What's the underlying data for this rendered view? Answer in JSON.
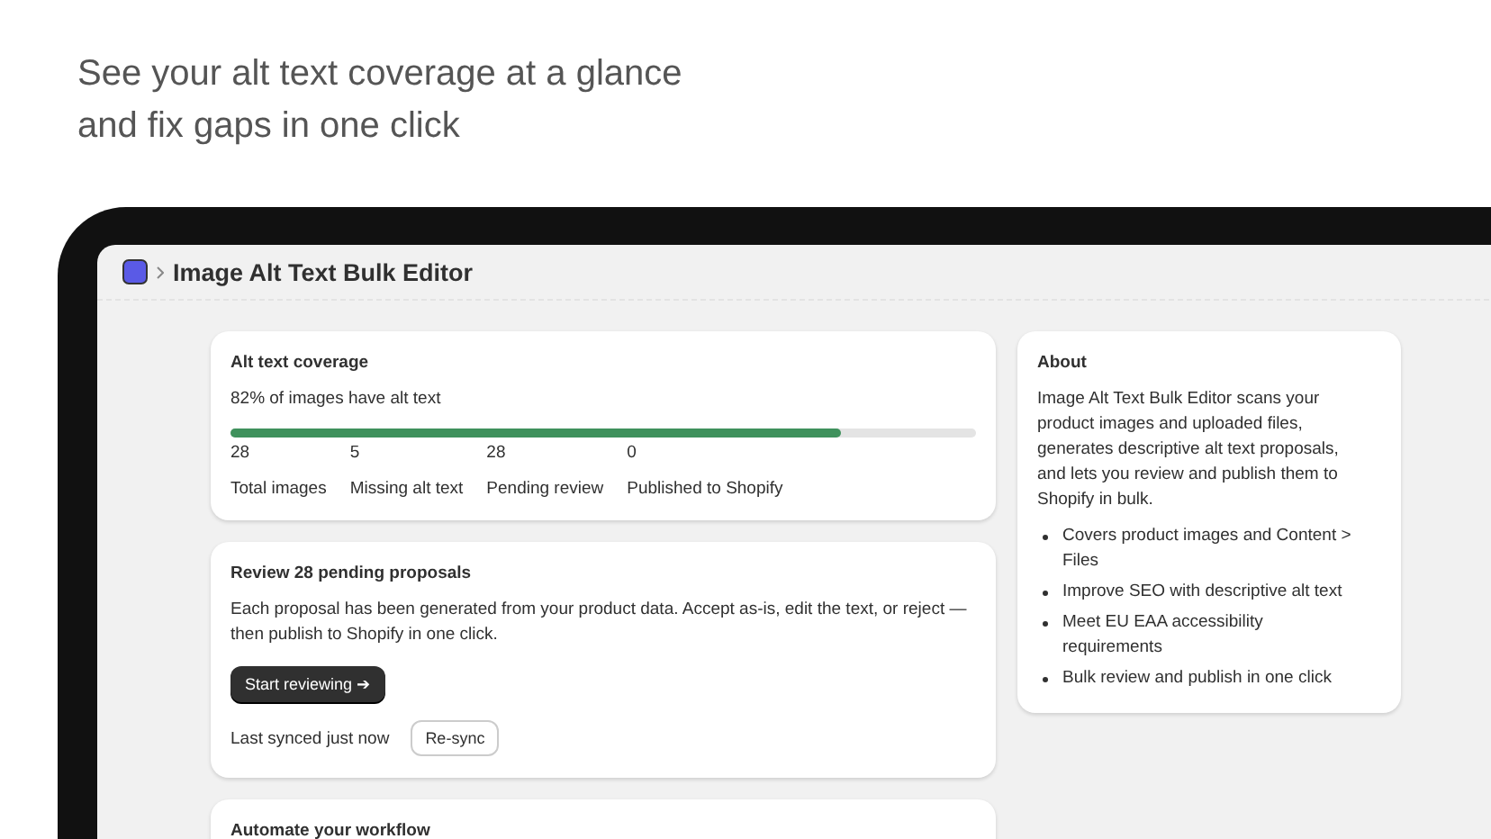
{
  "headline": [
    "See your alt text coverage at a glance",
    "and fix gaps in one click"
  ],
  "window": {
    "title": "Image Alt Text Bulk Editor"
  },
  "coverage": {
    "title": "Alt text coverage",
    "summary": "82% of images have alt text",
    "level": 0.82,
    "stats": [
      {
        "value": "28",
        "label": "Total images"
      },
      {
        "value": "5",
        "label": "Missing alt text"
      },
      {
        "value": "28",
        "label": "Pending review"
      },
      {
        "value": "0",
        "label": "Published to Shopify"
      }
    ]
  },
  "review": {
    "title": "Review 28 pending proposals",
    "text": "Each proposal has been generated from your product data. Accept as-is, edit the text, or reject — then publish to Shopify in one click.",
    "button": "Start reviewing ➔",
    "sync_status": "Last synced just now",
    "sync_button": "Re-sync"
  },
  "automate": {
    "title": "Automate your workflow"
  },
  "about": {
    "title": "About",
    "text": "Image Alt Text Bulk Editor scans your product images and uploaded files, generates descriptive alt text proposals, and lets you review and publish them to Shopify in bulk.",
    "bullets": [
      "Covers product images and Content > Files",
      "Improve SEO with descriptive alt text",
      "Meet EU EAA accessibility requirements",
      "Bulk review and publish in one click"
    ]
  }
}
